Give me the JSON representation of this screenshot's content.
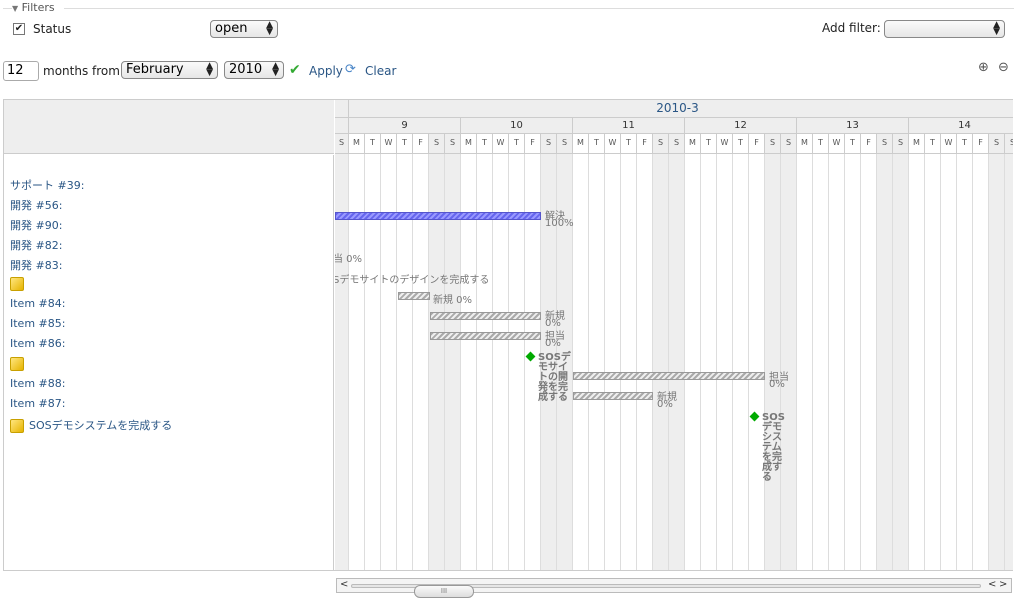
{
  "filters": {
    "legend": "Filters",
    "status_label": "Status",
    "status_value": "open",
    "add_filter_label": "Add filter:",
    "add_filter_value": ""
  },
  "controls": {
    "months": "12",
    "months_from_label": "months from",
    "month_value": "February",
    "year_value": "2010",
    "apply_label": "Apply",
    "clear_label": "Clear"
  },
  "gantt": {
    "month_label": "2010-3",
    "weeks": [
      "9",
      "10",
      "11",
      "12",
      "13",
      "14"
    ],
    "day_letters": [
      "M",
      "T",
      "W",
      "T",
      "F",
      "S",
      "S"
    ],
    "subjects": [
      {
        "label": "サポート #39:",
        "icon": ""
      },
      {
        "label": "開発 #56:",
        "icon": ""
      },
      {
        "label": "開発 #90:",
        "icon": ""
      },
      {
        "label": "開発 #82:",
        "icon": ""
      },
      {
        "label": "開発 #83:",
        "icon": ""
      },
      {
        "label": "",
        "icon": "package-icon"
      },
      {
        "label": "Item #84:",
        "icon": ""
      },
      {
        "label": "Item #85:",
        "icon": ""
      },
      {
        "label": "Item #86:",
        "icon": ""
      },
      {
        "label": "",
        "icon": "package-icon"
      },
      {
        "label": "Item #88:",
        "icon": ""
      },
      {
        "label": "Item #87:",
        "icon": ""
      },
      {
        "label": "SOSデモシステムを完成する",
        "icon": "package-icon"
      }
    ],
    "bar_labels": {
      "r90_status": "解決",
      "r90_pct": "100%",
      "r83": "当 0%",
      "version1": "Sデモサイトのデザインを完成する",
      "r84": "新規 0%",
      "r85_status": "新規",
      "r85_pct": "0%",
      "r86_status": "担当",
      "r86_pct": "0%",
      "ms1": "SOSデモサイトの開発を完成する",
      "r88_status": "担当",
      "r88_pct": "0%",
      "r87_status": "新規",
      "r87_pct": "0%",
      "ms2": "SOSデモシステムを完成する"
    }
  },
  "scroll": {
    "thumb_label": "III"
  }
}
